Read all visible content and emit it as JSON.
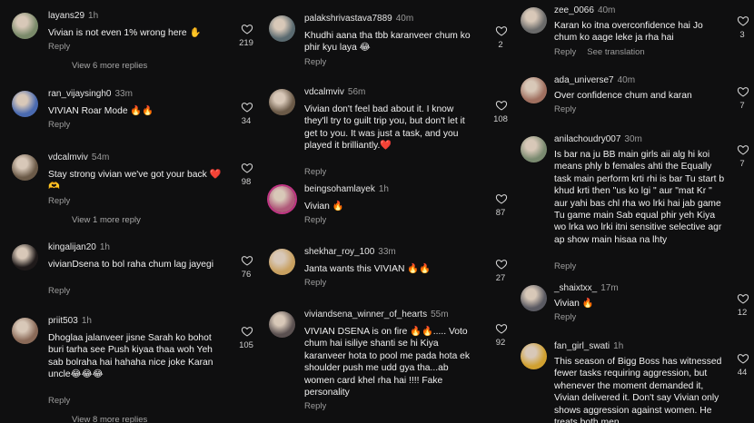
{
  "columns": [
    {
      "comments": [
        {
          "user": "layans29",
          "time": "1h",
          "text": "Vivian is not even 1% wrong here ✋",
          "reply": "Reply",
          "likes": "219",
          "view_replies": "View 6 more replies",
          "avatar": "#7a8a6a"
        },
        {
          "user": "ran_vijaysingh0",
          "time": "33m",
          "text": "VIVIAN Roar Mode 🔥🔥",
          "reply": "Reply",
          "likes": "34",
          "avatar": "#4a6ab0"
        },
        {
          "user": "vdcalmviv",
          "time": "54m",
          "text": "Stay strong vivian we've got your back ❤️🫶",
          "reply": "Reply",
          "likes": "98",
          "view_replies": "View 1 more reply",
          "avatar": "#6b5a48"
        },
        {
          "user": "kingalijan20",
          "time": "1h",
          "text": "vivianDsena to bol raha chum lag jayegi",
          "reply": "Reply",
          "likes": "76",
          "avatar": "#1f1a1a"
        },
        {
          "user": "priit503",
          "time": "1h",
          "text": "Dhoglaa jalanveer jisne Sarah ko bohot buri tarha see Push kiyaa thaa woh Yeh sab bolraha hai hahaha nice joke Karan uncle😂😂😂",
          "reply": "Reply",
          "likes": "105",
          "view_replies": "View 8 more replies",
          "avatar": "#8a6a58"
        }
      ]
    },
    {
      "comments": [
        {
          "user": "palakshrivastava7889",
          "time": "40m",
          "text": "Khudhi aana tha tbb karanveer chum ko phir kyu laya 😂",
          "reply": "Reply",
          "likes": "2",
          "avatar": "#5a6a70"
        },
        {
          "user": "vdcalmviv",
          "time": "56m",
          "text": "Vivian don't feel bad about it. I know they'll try to guilt trip you, but don't let it get to you. It was just a task, and you played it brilliantly.❤️",
          "reply": "Reply",
          "likes": "108",
          "avatar": "#6b5a48"
        },
        {
          "user": "beingsohamlayek",
          "time": "1h",
          "text": "Vivian 🔥",
          "reply": "Reply",
          "likes": "87",
          "avatar": "#b05a7a"
        },
        {
          "user": "shekhar_roy_100",
          "time": "33m",
          "text": "Janta wants this VIVIAN 🔥🔥",
          "reply": "Reply",
          "likes": "27",
          "avatar": "#c8a060"
        },
        {
          "user": "viviandsena_winner_of_hearts",
          "time": "55m",
          "text": "VIVIAN DSENA is on fire 🔥🔥..... Voto chum hai isiliye shanti se hi Kiya karanveer hota to pool me pada hota ek shoulder push me udd gya tha...ab women card khel rha hai !!!! Fake personality",
          "reply": "Reply",
          "likes": "92",
          "avatar": "#5a5050"
        }
      ]
    },
    {
      "comments": [
        {
          "user": "zee_0066",
          "time": "40m",
          "text": "Karan ko itna overconfidence hai Jo chum ko aage leke ja rha hai",
          "reply": "Reply",
          "translation": "See translation",
          "likes": "3",
          "avatar": "#6a6a6a"
        },
        {
          "user": "ada_universe7",
          "time": "40m",
          "text": "Over confidence chum and karan",
          "reply": "Reply",
          "likes": "7",
          "avatar": "#a07060"
        },
        {
          "user": "anilachoudry007",
          "time": "30m",
          "text": "Is bar na ju BB main girls aii alg hi koi means phly b females ahti the Equally task main perform krti rhi is bar Tu start b khud krti then \"us ko lgi \" aur \"mat Kr \" aur yahi bas chl rha wo lrki hai jab game Tu game main Sab equal phir yeh Kiya wo lrka wo lrki itni sensitive selective agr ap show main hisaa na lhty",
          "reply": "Reply",
          "likes": "7",
          "avatar": "#7a8a70"
        },
        {
          "user": "_shaixtxx_",
          "time": "17m",
          "text": "Vivian 🔥",
          "reply": "Reply",
          "likes": "12",
          "avatar": "#5a5a62"
        },
        {
          "user": "fan_girl_swati",
          "time": "1h",
          "text": "This season of Bigg Boss has witnessed fewer tasks requiring aggression, but whenever the moment demanded it, Vivian delivered it.  Don't say Vivian only shows aggression against women. He treats both men",
          "reply": "",
          "likes": "44",
          "avatar": "#d0a030"
        }
      ]
    }
  ]
}
